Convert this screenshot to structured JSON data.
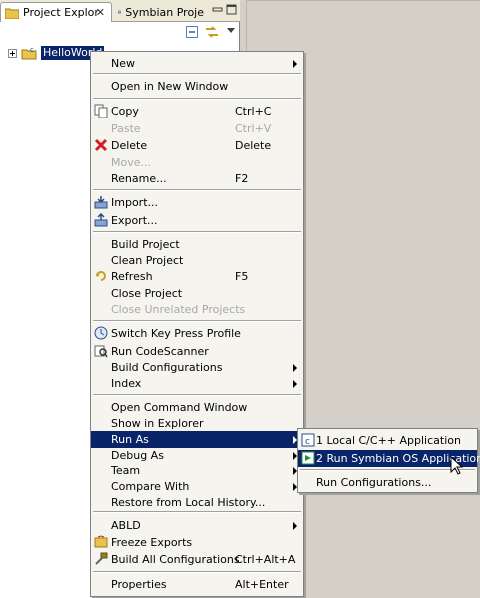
{
  "tabs": [
    {
      "label": "Project Explor",
      "active": true
    },
    {
      "label": "Symbian Proje",
      "active": false
    }
  ],
  "tree": {
    "project": "HelloWorld"
  },
  "context_menu": [
    {
      "label": "New",
      "arrow": true
    },
    {
      "label": "Open in New Window"
    },
    {
      "label": "Copy",
      "accel": "Ctrl+C",
      "icon": "copy-icon"
    },
    {
      "label": "Paste",
      "accel": "Ctrl+V",
      "disabled": true
    },
    {
      "label": "Delete",
      "accel": "Delete",
      "icon": "delete-icon"
    },
    {
      "label": "Move...",
      "disabled": true
    },
    {
      "label": "Rename...",
      "accel": "F2"
    },
    {
      "label": "Import...",
      "icon": "import-icon"
    },
    {
      "label": "Export...",
      "icon": "export-icon"
    },
    {
      "label": "Build Project"
    },
    {
      "label": "Clean Project"
    },
    {
      "label": "Refresh",
      "accel": "F5",
      "icon": "refresh-icon"
    },
    {
      "label": "Close Project"
    },
    {
      "label": "Close Unrelated Projects",
      "disabled": true
    },
    {
      "label": "Switch Key Press Profile",
      "icon": "switch-profile-icon"
    },
    {
      "label": "Run CodeScanner",
      "icon": "codescanner-icon"
    },
    {
      "label": "Build Configurations",
      "arrow": true
    },
    {
      "label": "Index",
      "arrow": true
    },
    {
      "label": "Open Command Window"
    },
    {
      "label": "Show in Explorer"
    },
    {
      "label": "Run As",
      "arrow": true,
      "selected": true
    },
    {
      "label": "Debug As",
      "arrow": true
    },
    {
      "label": "Team",
      "arrow": true
    },
    {
      "label": "Compare With",
      "arrow": true
    },
    {
      "label": "Restore from Local History..."
    },
    {
      "label": "ABLD",
      "arrow": true
    },
    {
      "label": "Freeze Exports",
      "icon": "freeze-exports-icon"
    },
    {
      "label": "Build All Configurations",
      "accel": "Ctrl+Alt+A",
      "icon": "build-all-icon"
    },
    {
      "label": "Properties",
      "accel": "Alt+Enter"
    }
  ],
  "submenu": [
    {
      "label": "1 Local C/C++ Application",
      "icon": "c-app-icon"
    },
    {
      "label": "2 Run Symbian OS Application",
      "icon": "symbian-app-icon",
      "selected": true
    },
    {
      "label": "Run Configurations..."
    }
  ],
  "colors": {
    "selection": "#0a246a",
    "menu_bg": "#f5f4ef",
    "chrome": "#d4d0c8"
  }
}
